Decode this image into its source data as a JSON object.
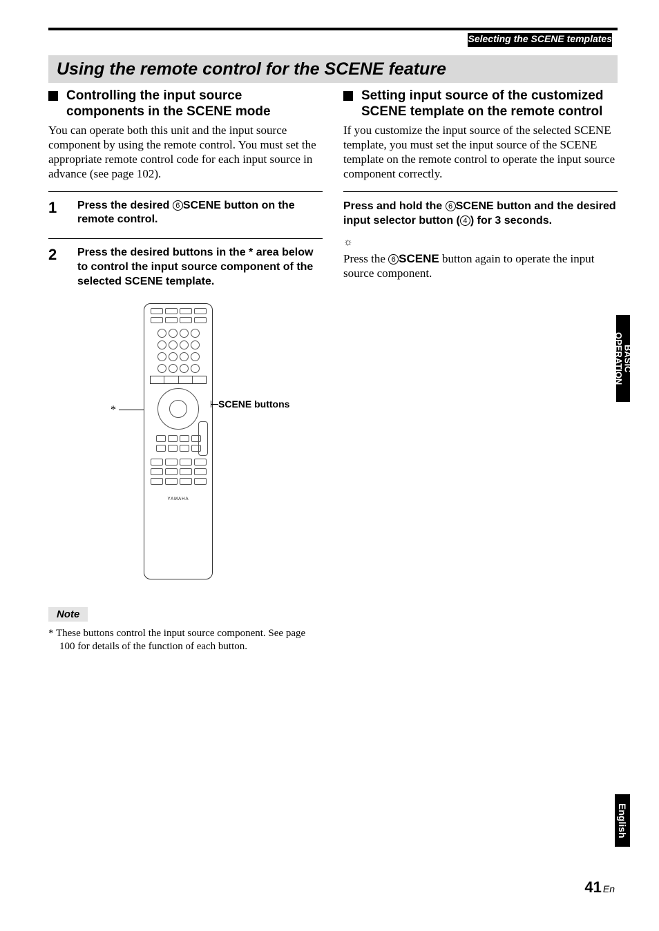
{
  "breadcrumb": "Selecting the SCENE templates",
  "section_title": "Using the remote control for the SCENE feature",
  "left": {
    "sub_heading": "Controlling the input source components in the SCENE mode",
    "intro": "You can operate both this unit and the input source component by using the remote control. You must set the appropriate remote control code for each input source in advance (see page 102).",
    "step1_num": "1",
    "step1_a": "Press the desired ",
    "step1_circ": "6",
    "step1_scene": "SCENE",
    "step1_b": " button on the remote control.",
    "step2_num": "2",
    "step2_text": "Press the desired buttons in the * area below to control the input source component of the selected SCENE template.",
    "asterisk": "*",
    "scene_buttons_label": "SCENE buttons",
    "remote_logo": "YAMAHA",
    "note_label": "Note",
    "note_text": "*  These buttons control the input source component. See page 100 for details of the function of each button."
  },
  "right": {
    "sub_heading": "Setting input source of the customized SCENE template on the remote control",
    "intro": "If you customize the input source of the selected SCENE template, you must set the input source of the SCENE template on the remote control to operate the input source component correctly.",
    "step_a": "Press and hold the ",
    "step_circ1": "6",
    "step_scene": "SCENE",
    "step_b": " button and the desired input selector button (",
    "step_circ2": "4",
    "step_c": ") for 3 seconds.",
    "hint_icon": "☼",
    "hint_a": "Press the ",
    "hint_circ": "6",
    "hint_scene": "SCENE",
    "hint_b": " button again to operate the input source component."
  },
  "side_tab_basic": "BASIC OPERATION",
  "side_tab_english": "English",
  "page_number": "41",
  "page_suffix": "En"
}
